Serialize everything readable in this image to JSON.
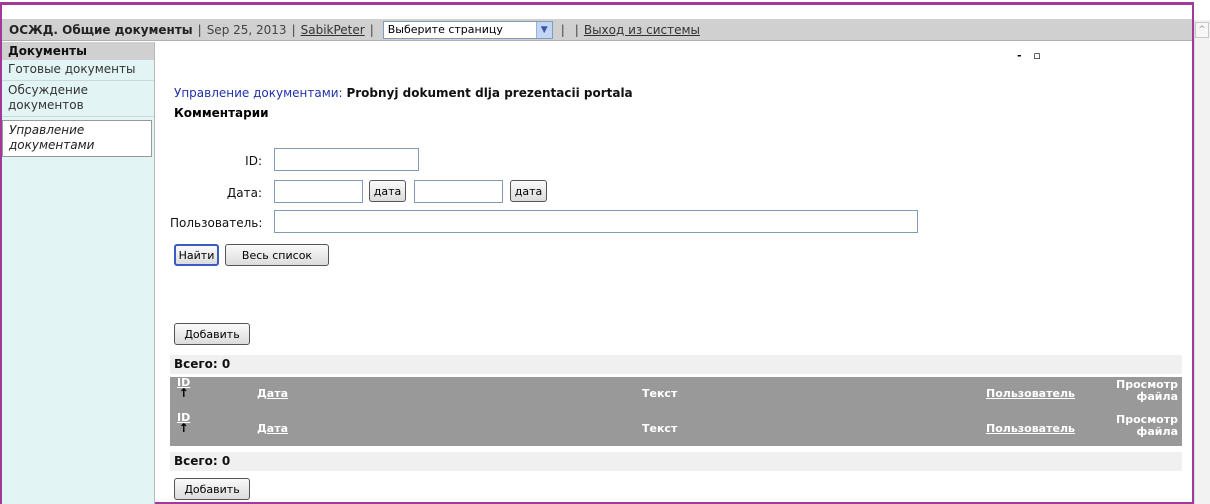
{
  "header": {
    "title": "ОСЖД. Общие документы",
    "date": "Sep 25, 2013",
    "user": "SabikPeter ",
    "page_select": "Выберите страницу",
    "logout": "Выход из системы"
  },
  "sidebar": {
    "heading": "Документы",
    "items": [
      {
        "label": "Готовые документы"
      },
      {
        "label": "Обсуждение документов"
      },
      {
        "label": "Управление документами"
      }
    ]
  },
  "main": {
    "breadcrumb_link": "Управление документами:",
    "document_title": "Probnyj dokument dlja prezentacii portala",
    "section_title": "Комментарии",
    "window_controls": "- ▫",
    "filter": {
      "id_label": "ID:",
      "date_label": "Дата:",
      "date_button": "дата",
      "user_label": "Пользователь:",
      "id_value": "",
      "date_from": "",
      "date_to": "",
      "user_value": ""
    },
    "buttons": {
      "find": "Найти",
      "full_list": "Весь список",
      "add": "Добавить"
    },
    "total": "Всего: 0",
    "table": {
      "columns": [
        "ID",
        "Дата",
        "Текст",
        "Пользователь",
        "Просмотр файла"
      ],
      "sort_arrow": "🠕"
    }
  }
}
